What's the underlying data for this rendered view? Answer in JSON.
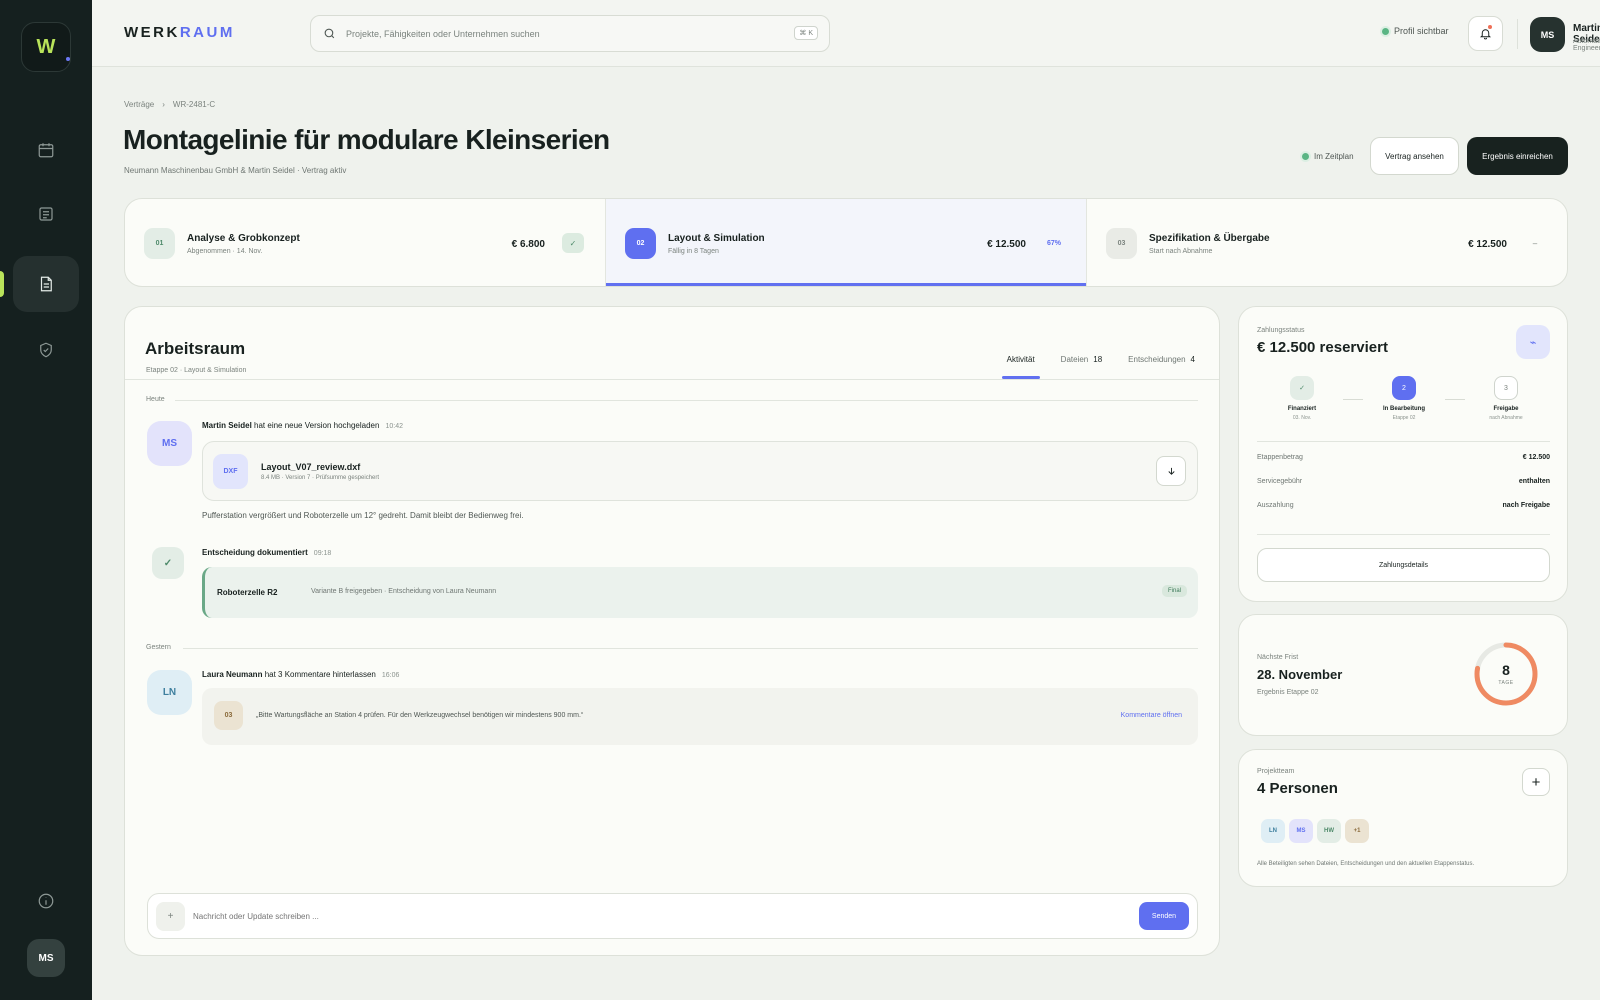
{
  "sidebar": {
    "logo_letter": "W",
    "icons": [
      "calendar-icon",
      "document-list-icon",
      "contract-icon",
      "shield-check-icon",
      "info-icon"
    ],
    "avatar_initials": "MS"
  },
  "header": {
    "brand_part1": "WERK",
    "brand_part2": "RAUM",
    "search_placeholder": "Projekte, Fähigkeiten oder Unternehmen suchen",
    "shortcut": "⌘ K",
    "profile_visible": "Profil sichtbar",
    "user": {
      "initials": "MS",
      "name": "Martin Seidel",
      "role": "Automation Engineer"
    }
  },
  "breadcrumb": {
    "parent": "Verträge",
    "separator": "›",
    "current": "WR-2481-C"
  },
  "page": {
    "title": "Montagelinie für modulare Kleinserien",
    "subtitle": "Neumann Maschinenbau GmbH & Martin Seidel · Vertrag aktiv",
    "schedule_status": "Im Zeitplan",
    "view_contract_label": "Vertrag ansehen",
    "submit_label": "Ergebnis einreichen"
  },
  "stages": [
    {
      "num": "01",
      "title": "Analyse & Grobkonzept",
      "sub": "Abgenommen · 14. Nov.",
      "amount": "€ 6.800",
      "end": "✓",
      "state": "done"
    },
    {
      "num": "02",
      "title": "Layout & Simulation",
      "sub": "Fällig in 8 Tagen",
      "amount": "€ 12.500",
      "end": "67%",
      "state": "active",
      "progress": 0.67
    },
    {
      "num": "03",
      "title": "Spezifikation & Übergabe",
      "sub": "Start nach Abnahme",
      "amount": "€ 12.500",
      "end": "–",
      "state": "pending"
    }
  ],
  "workspace": {
    "title": "Arbeitsraum",
    "subtitle": "Etappe 02 · Layout & Simulation",
    "tabs": [
      {
        "label": "Aktivität",
        "count": ""
      },
      {
        "label": "Dateien",
        "count": "18"
      },
      {
        "label": "Entscheidungen",
        "count": "4"
      }
    ],
    "day_today": "Heute",
    "day_yesterday": "Gestern",
    "activity1": {
      "initials": "MS",
      "actor": "Martin Seidel",
      "action": " hat eine neue Version hochgeladen",
      "time": "10:42",
      "file_type": "DXF",
      "file_name": "Layout_V07_review.dxf",
      "file_meta": "8.4 MB · Version 7 · Prüfsumme gespeichert",
      "note": "Pufferstation vergrößert und Roboterzelle um 12° gedreht. Damit bleibt der Bedienweg frei."
    },
    "activity2": {
      "title": "Entscheidung dokumentiert",
      "time": "09:18",
      "decision_title": "Roboterzelle R2",
      "decision_text": "Variante B freigegeben · Entscheidung von Laura Neumann",
      "tag": "Final"
    },
    "activity3": {
      "initials": "LN",
      "actor": "Laura Neumann",
      "action": " hat 3 Kommentare hinterlassen",
      "time": "16:06",
      "count": "03",
      "quote": "„Bitte Wartungsfläche an Station 4 prüfen. Für den Werkzeugwechsel benötigen wir mindestens 900 mm.“",
      "link": "Kommentare öffnen"
    },
    "composer": {
      "plus": "+",
      "placeholder": "Nachricht oder Update schreiben ...",
      "send": "Senden"
    }
  },
  "payment": {
    "label": "Zahlungsstatus",
    "title": "€ 12.500 reserviert",
    "steps": [
      {
        "mark": "✓",
        "name": "Finanziert",
        "sub": "03. Nov."
      },
      {
        "mark": "2",
        "name": "In Bearbeitung",
        "sub": "Etappe 02"
      },
      {
        "mark": "3",
        "name": "Freigabe",
        "sub": "nach Abnahme"
      }
    ],
    "rows": [
      {
        "k": "Etappenbetrag",
        "v": "€ 12.500"
      },
      {
        "k": "Servicegebühr",
        "v": "enthalten"
      },
      {
        "k": "Auszahlung",
        "v": "nach Freigabe"
      }
    ],
    "button": "Zahlungsdetails"
  },
  "deadline": {
    "label": "Nächste Frist",
    "date": "28. November",
    "sub": "Ergebnis Etappe 02",
    "days": "8",
    "unit": "TAGE",
    "ring_fraction": 0.78
  },
  "team": {
    "label": "Projektteam",
    "title": "4 Personen",
    "members": [
      "LN",
      "MS",
      "HW",
      "+1"
    ],
    "note": "Alle Beteiligten sehen Dateien, Entscheidungen und den aktuellen Etappenstatus."
  },
  "colors": {
    "accent": "#5f6ff0",
    "lime": "#b9e35a",
    "sidebar": "#15201f",
    "success": "#5ab584",
    "deadline_ring": "#ef8a62"
  }
}
